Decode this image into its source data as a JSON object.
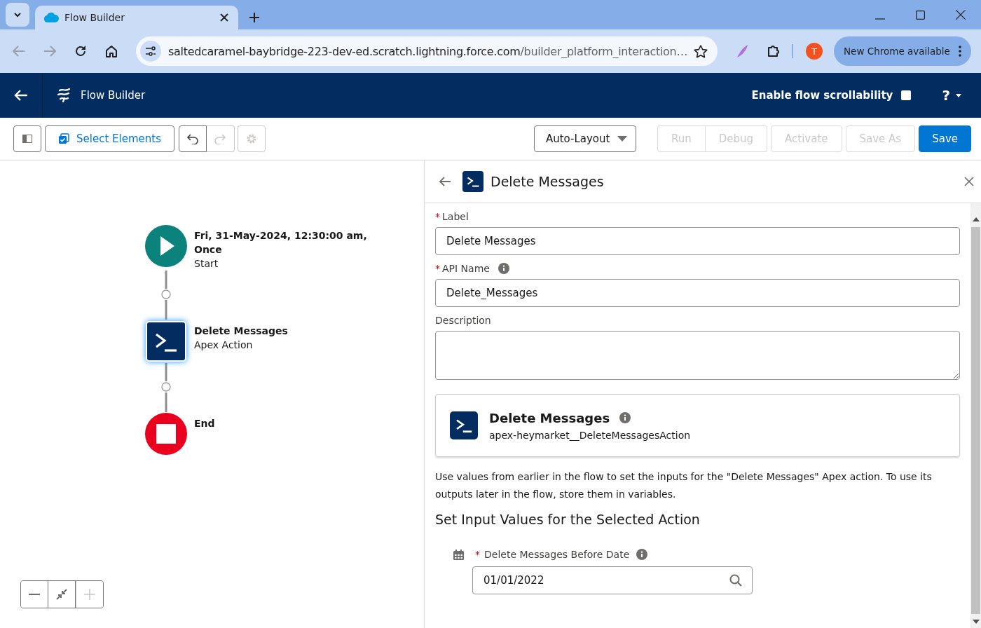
{
  "browser": {
    "tab_title": "Flow Builder",
    "url_host": "saltedcaramel-baybridge-223-dev-ed.scratch.lightning.force.com",
    "url_path": "/builder_platform_interaction…",
    "avatar": "T",
    "update_label": "New Chrome available"
  },
  "app_header": {
    "title": "Flow Builder",
    "scroll_toggle": {
      "label": "Enable flow scrollability",
      "checked": false
    },
    "help_label": "?"
  },
  "toolbar": {
    "select_button": "Select Elements",
    "undo_disabled": false,
    "redo_disabled": true,
    "settings_disabled": true,
    "layout": "Auto-Layout",
    "buttons": [
      {
        "label": "Run",
        "disabled": true,
        "kind": "group"
      },
      {
        "label": "Debug",
        "disabled": true,
        "kind": "group"
      },
      {
        "label": "Activate",
        "disabled": true,
        "kind": "single"
      },
      {
        "label": "Save As",
        "disabled": true,
        "kind": "single"
      },
      {
        "label": "Save",
        "disabled": false,
        "kind": "primary"
      }
    ]
  },
  "canvas": {
    "nodes": [
      {
        "kind": "start",
        "title": "Fri, 31-May-2024, 12:30:00 am, Once",
        "subtitle": "Start",
        "selected": false
      },
      {
        "kind": "action",
        "title": "Delete Messages",
        "subtitle": "Apex Action",
        "selected": true
      },
      {
        "kind": "end",
        "title": "End",
        "selected": false
      }
    ],
    "zoom_in_disabled": true
  },
  "panel": {
    "title": "Delete Messages",
    "required_mark": "*",
    "fields": [
      {
        "kind": "text",
        "label": "Label",
        "required": true,
        "info": false,
        "value": "Delete Messages"
      },
      {
        "kind": "text",
        "label": "API Name",
        "required": true,
        "info": true,
        "value": "Delete_Messages"
      },
      {
        "kind": "textarea",
        "label": "Description",
        "required": false,
        "info": false
      }
    ],
    "action_card": {
      "title": "Delete Messages",
      "api_name": "apex-heymarket__DeleteMessagesAction"
    },
    "help_text": "Use values from earlier in the flow to set the inputs for the \"Delete Messages\" Apex action. To use its outputs later in the flow, store them in variables.",
    "section_title": "Set Input Values for the Selected Action",
    "inputs": [
      {
        "label": "Delete Messages Before Date",
        "required": true,
        "value": "01/01/2022"
      }
    ]
  }
}
